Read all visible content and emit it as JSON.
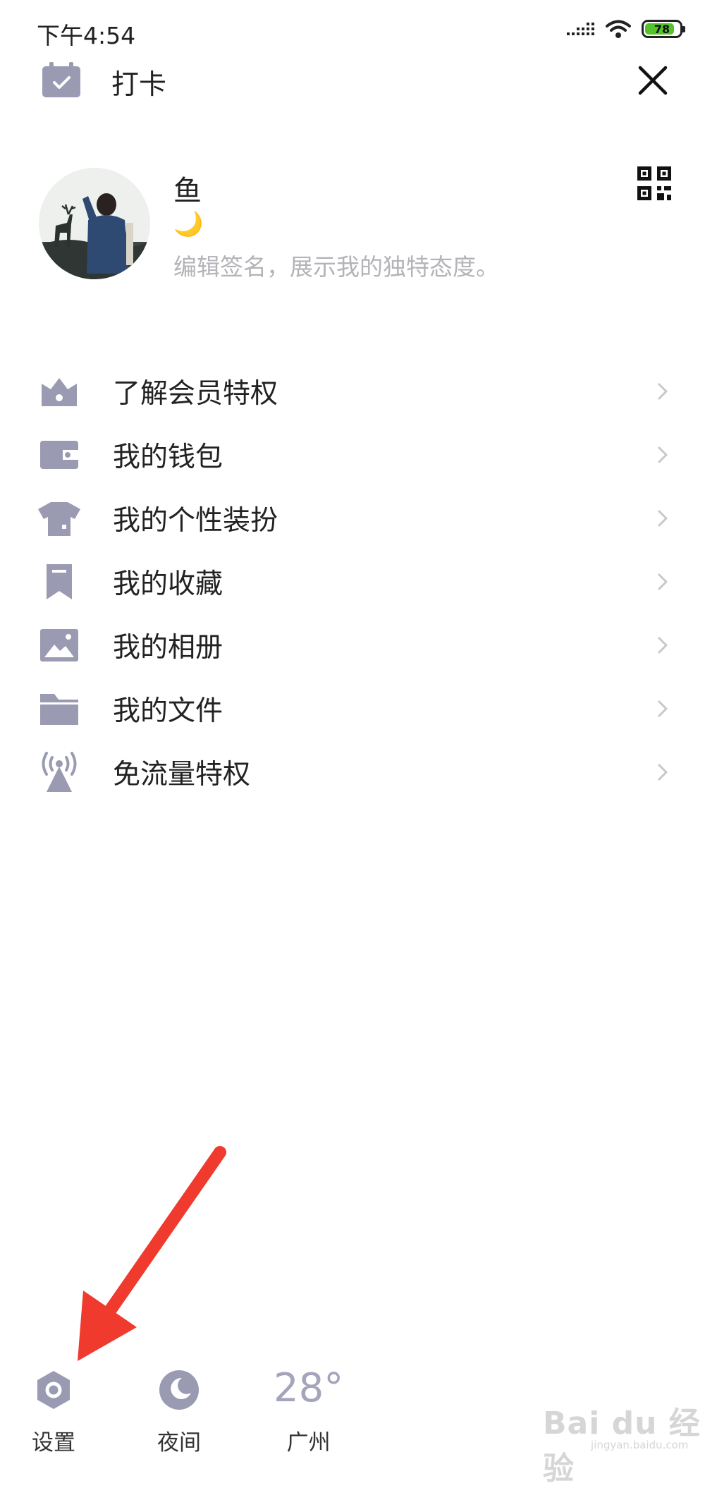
{
  "status_bar": {
    "time": "下午4:54",
    "battery": "78",
    "battery_color": "#53c22b"
  },
  "top_bar": {
    "checkin_label": "打卡",
    "checkin_icon": "calendar-check-icon",
    "close_icon": "close-icon"
  },
  "profile": {
    "name": "鱼",
    "status_emoji": "🌙",
    "signature_placeholder": "编辑签名，展示我的独特态度。",
    "qr_icon": "qr-code-icon"
  },
  "menu": {
    "items": [
      {
        "label": "了解会员特权",
        "icon": "crown-icon"
      },
      {
        "label": "我的钱包",
        "icon": "wallet-icon"
      },
      {
        "label": "我的个性装扮",
        "icon": "shirt-icon"
      },
      {
        "label": "我的收藏",
        "icon": "bookmark-icon"
      },
      {
        "label": "我的相册",
        "icon": "photo-icon"
      },
      {
        "label": "我的文件",
        "icon": "folder-icon"
      },
      {
        "label": "免流量特权",
        "icon": "signal-tower-icon"
      }
    ]
  },
  "bottom_bar": {
    "settings_label": "设置",
    "night_label": "夜间",
    "weather_temp": "28°",
    "weather_city": "广州"
  },
  "watermark": {
    "text": "Bai du 经验",
    "sub": "jingyan.baidu.com"
  },
  "colors": {
    "icon_gray": "#9a9bb2",
    "annotation_red": "#f03a2e"
  }
}
